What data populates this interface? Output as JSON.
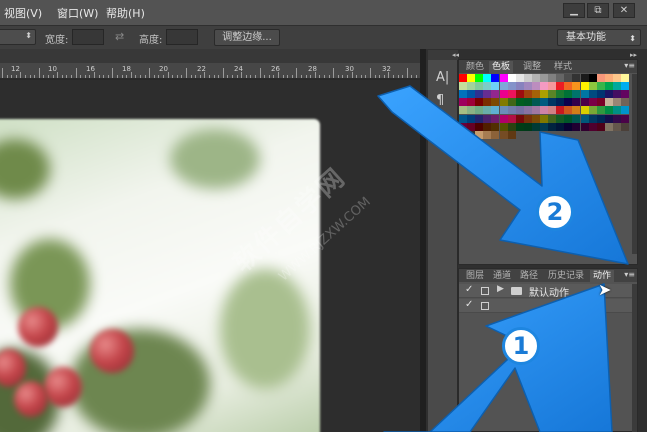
{
  "menubar": {
    "items": [
      "视图(V)",
      "窗口(W)",
      "帮助(H)"
    ],
    "window_buttons": [
      "▁",
      "⧉",
      "✕"
    ]
  },
  "options_bar": {
    "width_label": "宽度:",
    "height_label": "高度:",
    "refine_edge_label": "调整边缘...",
    "workspace_value": "基本功能"
  },
  "ruler": {
    "labels": [
      "12",
      "10",
      "16",
      "18",
      "20",
      "22",
      "24",
      "26",
      "28",
      "30",
      "32"
    ]
  },
  "icon_strip": {
    "icons": [
      "character-icon",
      "paragraph-icon"
    ],
    "glyphs": [
      "A|",
      "¶"
    ]
  },
  "swatch_panel": {
    "tabs": [
      "颜色",
      "色板",
      "调整",
      "样式"
    ],
    "active_tab": "色板"
  },
  "actions_panel": {
    "tabs": [
      "图层",
      "通道",
      "路径",
      "历史记录",
      "动作"
    ],
    "active_tab": "动作",
    "rows": [
      {
        "check": "✓",
        "name": "默认动作"
      },
      {
        "check": "✓",
        "name": ""
      }
    ]
  },
  "annotations": {
    "badge_1": "1",
    "badge_2": "2",
    "watermark_text": "软件自学网",
    "watermark_url": "WWW.RJZXW.COM"
  },
  "colors": {
    "arrow_blue": "#1f8ef0",
    "badge_blue": "#1a7bd6",
    "menubar_bg": "#535353",
    "panel_bg": "#535353"
  }
}
